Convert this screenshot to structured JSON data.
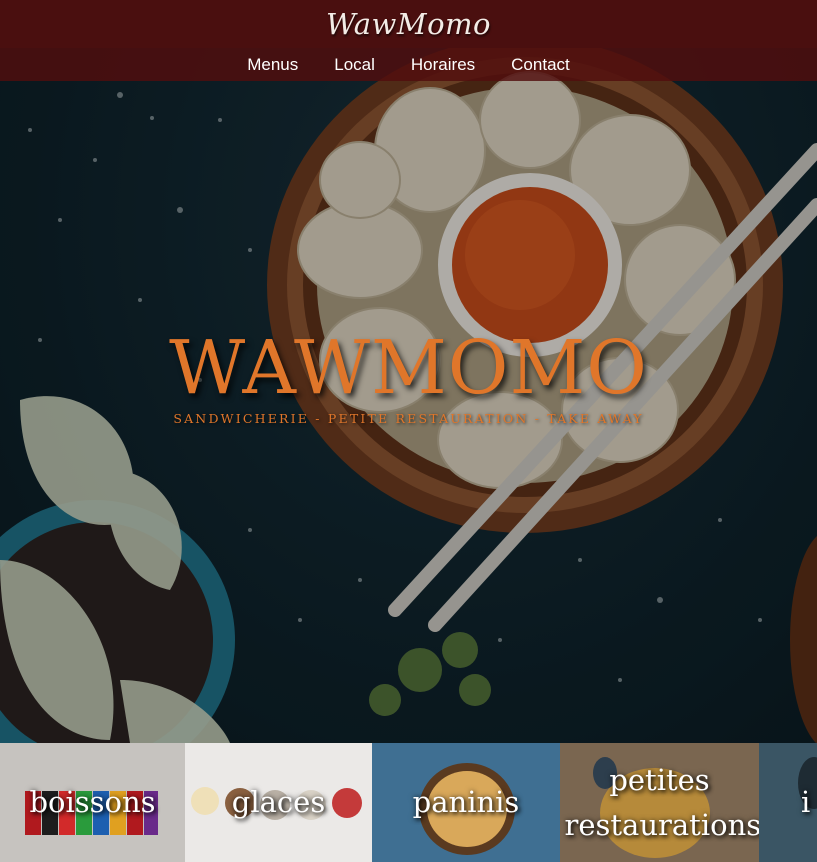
{
  "header": {
    "brand": "WawMomo",
    "nav": [
      {
        "label": "Menus"
      },
      {
        "label": "Local"
      },
      {
        "label": "Horaires"
      },
      {
        "label": "Contact"
      }
    ]
  },
  "hero": {
    "title": "WAWMOMO",
    "subtitle": "SANDWICHERIE - PETITE RESTAURATION - TAKE AWAY",
    "scroll_icon": "arrow-down-icon"
  },
  "categories": [
    {
      "label": "boissons"
    },
    {
      "label": "glaces"
    },
    {
      "label": "paninis"
    },
    {
      "label": "petites restaurations"
    },
    {
      "label": "i"
    }
  ],
  "colors": {
    "header_bg": "#4a0f0f",
    "nav_bg": "#520e0e",
    "accent_orange": "#e0762a",
    "hero_bg": "#0f232c"
  }
}
